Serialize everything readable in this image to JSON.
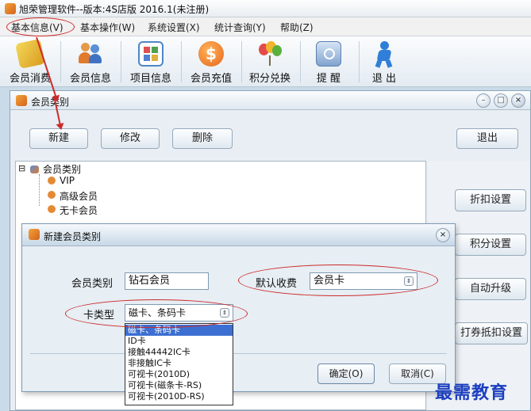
{
  "app": {
    "title": "旭荣管理软件--版本:4S店版 2016.1(未注册)"
  },
  "menu": [
    "基本信息(V)",
    "基本操作(W)",
    "系统设置(X)",
    "统计查询(Y)",
    "帮助(Z)"
  ],
  "toolbar": [
    {
      "label": "会员消费",
      "icon": "vip-card-icon",
      "color": "#e8c23a"
    },
    {
      "label": "会员信息",
      "icon": "members-icon",
      "color": "#e07a2c"
    },
    {
      "label": "项目信息",
      "icon": "grid-icon",
      "color": "#4f86c6"
    },
    {
      "label": "会员充值",
      "icon": "dollar-coin-icon",
      "color": "#e5661c"
    },
    {
      "label": "积分兑换",
      "icon": "balloons-icon",
      "color": "#5ab03c"
    },
    {
      "label": "提 醒",
      "icon": "reminder-icon",
      "color": "#6f97c9"
    },
    {
      "label": "退 出",
      "icon": "exit-person-icon",
      "color": "#2f7fd8"
    }
  ],
  "window": {
    "title": "会员类别",
    "buttons": {
      "new": "新建",
      "edit": "修改",
      "delete": "删除",
      "exit": "退出"
    },
    "side_buttons": [
      "折扣设置",
      "积分设置",
      "自动升级",
      "打券抵扣设置"
    ]
  },
  "tree": {
    "root": "会员类别",
    "expander": "⊟",
    "items": [
      "VIP",
      "高级会员",
      "无卡会员"
    ]
  },
  "dialog": {
    "title": "新建会员类别",
    "member_type_label": "会员类别",
    "member_type_value": "钻石会员",
    "fee_label": "默认收费",
    "fee_value": "会员卡",
    "card_type_label": "卡类型",
    "card_type_value": "磁卡、条码卡",
    "ok": "确定(O)",
    "cancel": "取消(C)"
  },
  "card_type_options": [
    "磁卡、条码卡",
    "ID卡",
    "接触44442IC卡",
    "非接触IC卡",
    "可视卡(2010D)",
    "可视卡(磁条卡-RS)",
    "可视卡(2010D-RS)"
  ],
  "watermark": "最需教育",
  "colors": {
    "annotation": "#cc2a2a",
    "selection": "#3c6fd1",
    "watermark": "#1d3fbf"
  }
}
